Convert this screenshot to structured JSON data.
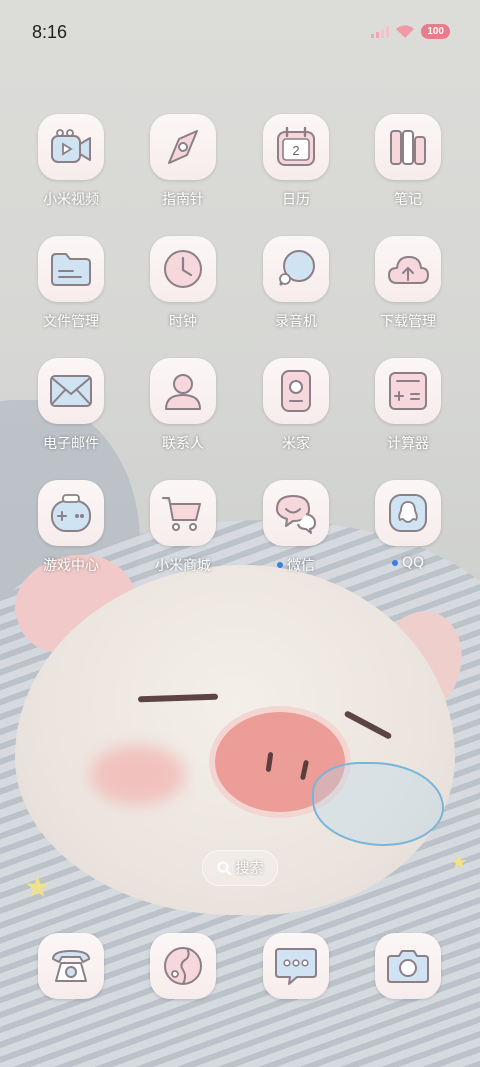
{
  "status_bar": {
    "time": "8:16",
    "battery": "100"
  },
  "apps": [
    {
      "label": "小米视频",
      "icon": "video-camera-icon"
    },
    {
      "label": "指南针",
      "icon": "compass-icon"
    },
    {
      "label": "日历",
      "icon": "calendar-icon",
      "calendar_day": "2"
    },
    {
      "label": "笔记",
      "icon": "notes-icon"
    },
    {
      "label": "文件管理",
      "icon": "folder-icon"
    },
    {
      "label": "时钟",
      "icon": "clock-icon"
    },
    {
      "label": "录音机",
      "icon": "recorder-icon"
    },
    {
      "label": "下载管理",
      "icon": "cloud-download-icon"
    },
    {
      "label": "电子邮件",
      "icon": "mail-icon"
    },
    {
      "label": "联系人",
      "icon": "contact-icon"
    },
    {
      "label": "米家",
      "icon": "mijia-icon"
    },
    {
      "label": "计算器",
      "icon": "calculator-icon"
    },
    {
      "label": "游戏中心",
      "icon": "gamepad-icon"
    },
    {
      "label": "小米商城",
      "icon": "shopping-cart-icon"
    },
    {
      "label": "微信",
      "icon": "wechat-icon",
      "has_notification_dot": true
    },
    {
      "label": "QQ",
      "icon": "qq-penguin-icon",
      "has_notification_dot": true
    }
  ],
  "search": {
    "label": "搜索"
  },
  "dock": [
    {
      "icon": "phone-icon"
    },
    {
      "icon": "browser-icon"
    },
    {
      "icon": "messages-icon"
    },
    {
      "icon": "camera-icon"
    }
  ],
  "colors": {
    "icon_line": "#8c7f86",
    "icon_fill_blue": "#cfe3f3",
    "icon_fill_pink": "#f6d7dc",
    "dot": "#3d7ee8"
  }
}
